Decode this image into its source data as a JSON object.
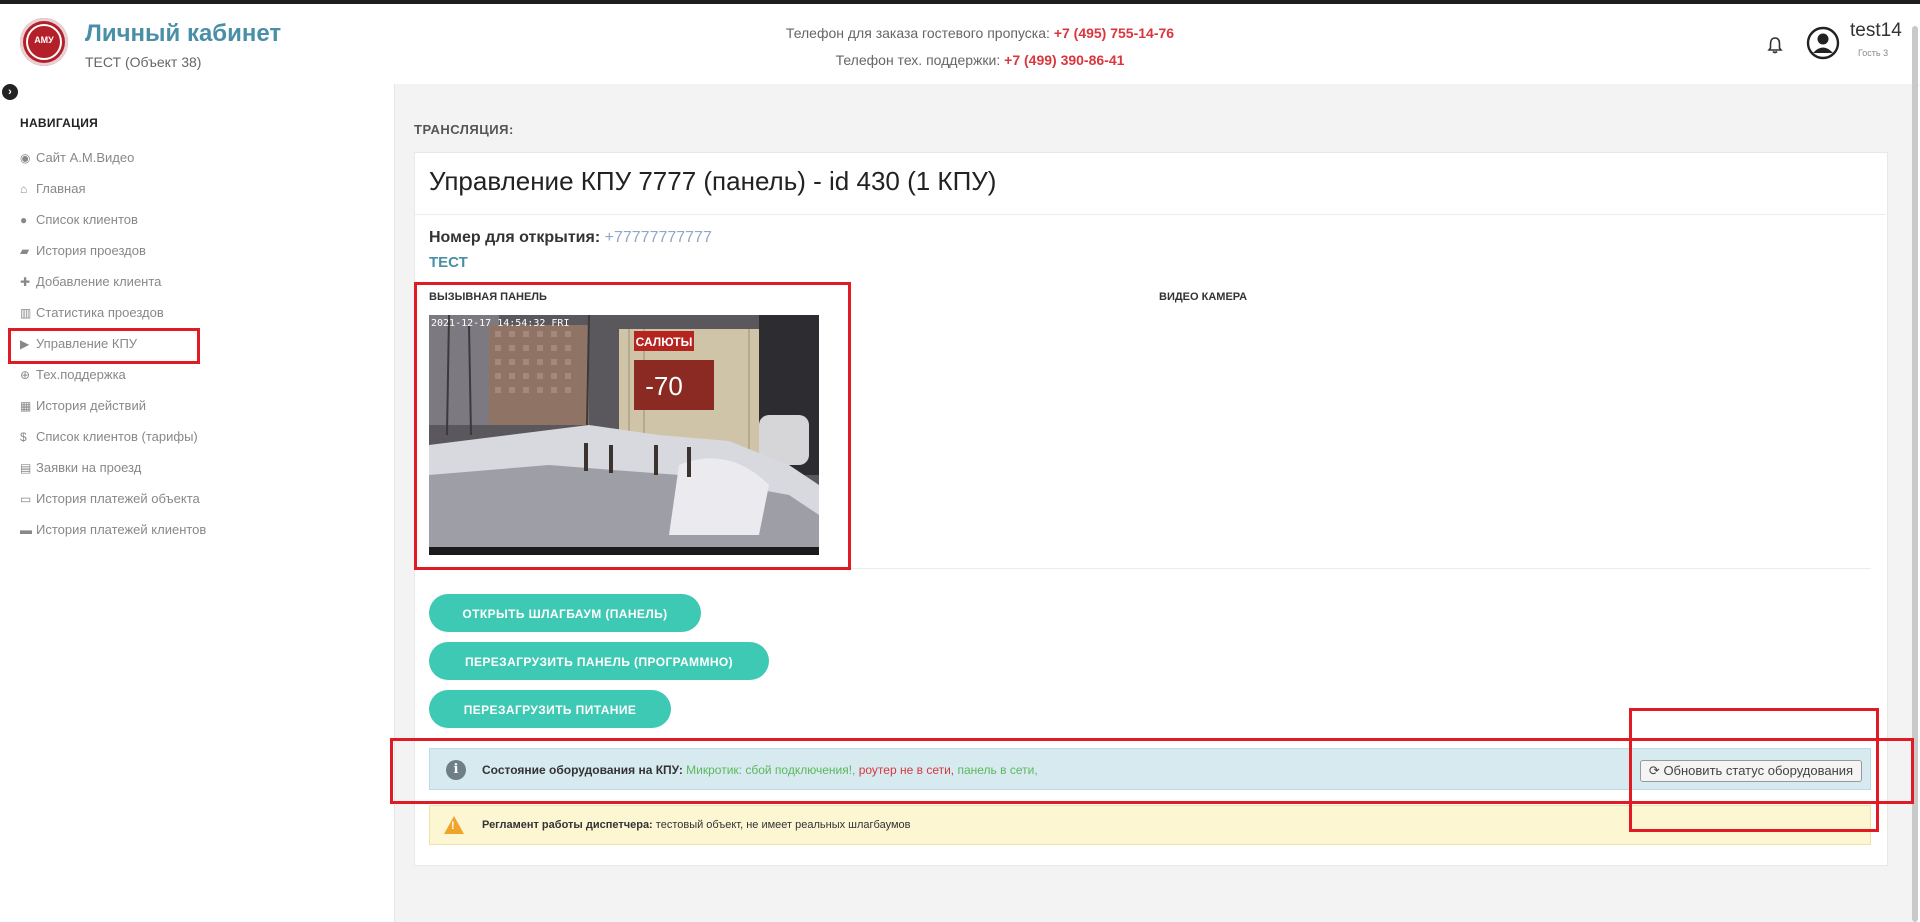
{
  "header": {
    "title": "Личный кабинет",
    "subtitle": "ТЕСТ (Объект 38)",
    "logo_text": "АМУ",
    "phone_guest_label": "Телефон для заказа гостевого пропуска:",
    "phone_guest_value": "+7 (495) 755-14-76",
    "phone_support_label": "Телефон тех. поддержки:",
    "phone_support_value": "+7 (499) 390-86-41",
    "user_name": "test14",
    "user_role": "Гость 3"
  },
  "sidebar": {
    "title": "НАВИГАЦИЯ",
    "items": [
      {
        "label": "Сайт А.М.Видео",
        "icon": "globe-icon",
        "glyph": "◉"
      },
      {
        "label": "Главная",
        "icon": "home-icon",
        "glyph": "⌂"
      },
      {
        "label": "Список клиентов",
        "icon": "user-icon",
        "glyph": "●"
      },
      {
        "label": "История проездов",
        "icon": "car-icon",
        "glyph": "▰"
      },
      {
        "label": "Добавление клиента",
        "icon": "user-plus-icon",
        "glyph": "✚"
      },
      {
        "label": "Статистика проездов",
        "icon": "bar-chart-icon",
        "glyph": "▥"
      },
      {
        "label": "Управление КПУ",
        "icon": "video-camera-icon",
        "glyph": "▶"
      },
      {
        "label": "Тех.поддержка",
        "icon": "lifebuoy-icon",
        "glyph": "⊕"
      },
      {
        "label": "История действий",
        "icon": "calendar-icon",
        "glyph": "▦"
      },
      {
        "label": "Список клиентов (тарифы)",
        "icon": "dollar-icon",
        "glyph": "$"
      },
      {
        "label": "Заявки на проезд",
        "icon": "book-icon",
        "glyph": "▤"
      },
      {
        "label": "История платежей объекта",
        "icon": "credit-card-icon",
        "glyph": "▭"
      },
      {
        "label": "История платежей клиентов",
        "icon": "credit-card-icon",
        "glyph": "▬"
      }
    ]
  },
  "main": {
    "section_title": "ТРАНСЛЯЦИЯ:",
    "card_title": "Управление КПУ 7777 (панель) - id 430 (1 КПУ)",
    "open_number_label": "Номер для открытия:",
    "open_number_value": "+77777777777",
    "tenant": "ТЕСТ",
    "panel_label": "ВЫЗЫВНАЯ ПАНЕЛЬ",
    "video_label": "ВИДЕО КАМЕРА",
    "camera": {
      "timestamp": "2021-12-17 14:54:32 FRI",
      "sign_text": "САЛЮТЫ",
      "banner_text": "-70"
    },
    "buttons": {
      "open_barrier": "ОТКРЫТЬ ШЛАГБАУМ (ПАНЕЛЬ)",
      "reboot_panel": "ПЕРЕЗАГРУЗИТЬ ПАНЕЛЬ (ПРОГРАММНО)",
      "reboot_power": "ПЕРЕЗАГРУЗИТЬ ПИТАНИЕ"
    },
    "status": {
      "label": "Состояние оборудования на КПУ:",
      "mikrotik": "Микротик: сбой подключения!,",
      "router": "роутер не в сети,",
      "panel": "панель в сети,",
      "refresh_button": "Обновить статус оборудования"
    },
    "dispatcher": {
      "label": "Регламент работы диспетчера:",
      "text": "тестовый объект, не имеет реальных шлагбаумов"
    }
  },
  "colors": {
    "accent": "#4a8fa8",
    "button": "#3ec9b5",
    "phone": "#d9363e",
    "highlight": "#e01b24"
  }
}
